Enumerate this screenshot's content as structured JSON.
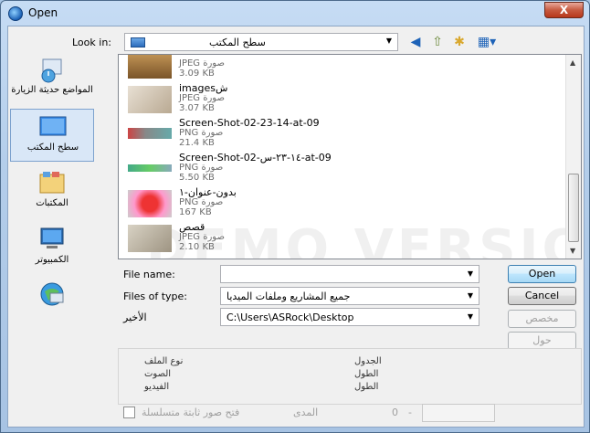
{
  "window": {
    "title": "Open",
    "close_label": "X"
  },
  "toolbar": {
    "look_in_label": "Look in:",
    "look_in_value": "سطح المكتب",
    "icons": [
      "back-icon",
      "up-folder-icon",
      "new-folder-icon",
      "view-menu-icon"
    ]
  },
  "places": [
    {
      "label": "المواضع حديثة الزيارة",
      "icon": "recent-places-icon"
    },
    {
      "label": "سطح المكتب",
      "icon": "desktop-icon",
      "selected": true
    },
    {
      "label": "المكتبات",
      "icon": "libraries-icon"
    },
    {
      "label": "الكمبيوتر",
      "icon": "computer-icon"
    },
    {
      "label": "",
      "icon": "network-icon"
    }
  ],
  "files": [
    {
      "name": "",
      "type": "JPEG صورة",
      "size": "3.09 KB"
    },
    {
      "name": "imagesش",
      "type": "JPEG صورة",
      "size": "3.07 KB"
    },
    {
      "name": "Screen-Shot-02-23-14-at-09",
      "type": "PNG صورة",
      "size": "21.4 KB"
    },
    {
      "name": "Screen-Shot-02-١٤-٢٣-س-at-09",
      "type": "PNG صورة",
      "size": "5.50 KB"
    },
    {
      "name": "بدون-عنوان-١",
      "type": "PNG صورة",
      "size": "167 KB"
    },
    {
      "name": "قصص",
      "type": "JPEG صورة",
      "size": "2.10 KB"
    }
  ],
  "watermark": "DEMO VERSION",
  "form": {
    "file_name_label": "File name:",
    "file_name_value": "",
    "files_of_type_label": "Files of type:",
    "files_of_type_value": "جميع المشاريع وملفات الميديا",
    "recent_label": "الأخير",
    "recent_value": "C:\\Users\\ASRock\\Desktop"
  },
  "buttons": {
    "open": "Open",
    "cancel": "Cancel",
    "customize": "مخصص",
    "about": "حول"
  },
  "info": {
    "file_type": "نوع الملف",
    "audio": "الصوت",
    "video": "الفيديو",
    "table": "الجدول",
    "length1": "الطول",
    "length2": "الطول"
  },
  "bottom": {
    "sequence_label": "فتح صور ثابتة متسلسلة",
    "range_label": "المدى",
    "range_from": "0",
    "range_sep": "-",
    "range_to": ""
  }
}
